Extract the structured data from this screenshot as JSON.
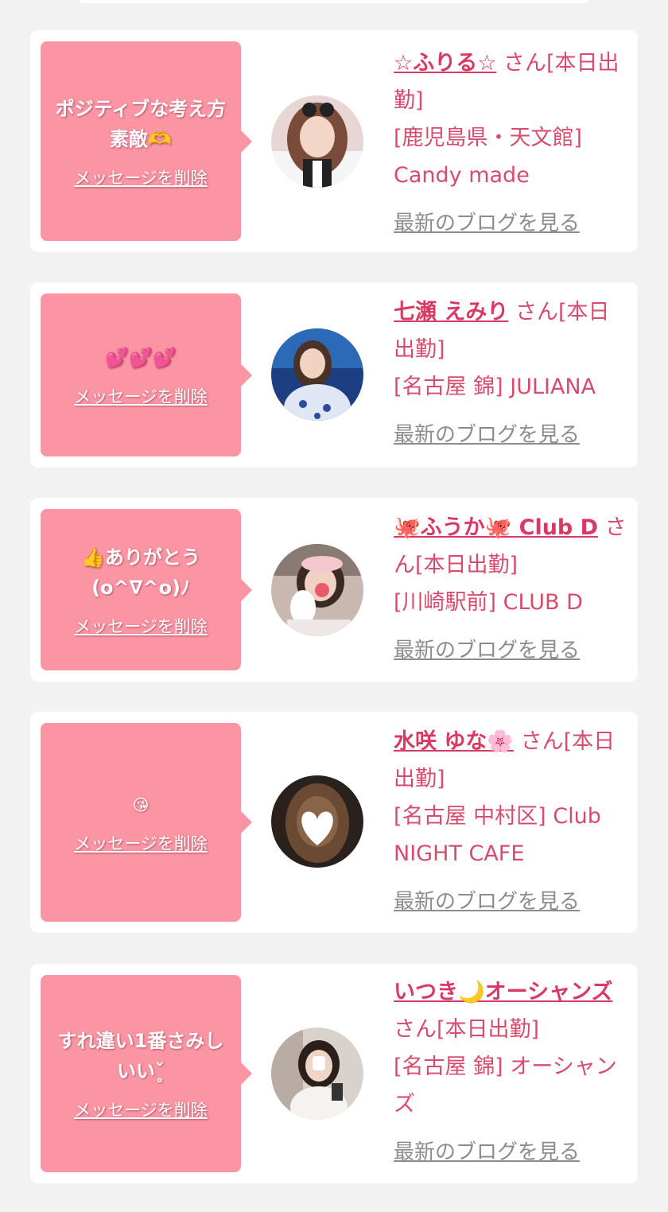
{
  "messages": [
    {
      "message": "ポジティブな考え方素敵🫶",
      "delete_label": "メッセージを削除",
      "name": "☆ふりる☆",
      "suffix": "さん[本日出勤]",
      "shop": "[鹿児島県・天文館] Candy made",
      "blog_label": "最新のブログを見る"
    },
    {
      "message": "💕💕💕",
      "delete_label": "メッセージを削除",
      "name": "七瀬 えみり",
      "suffix": "さん[本日出勤]",
      "shop": "[名古屋 錦] JULIANA",
      "blog_label": "最新のブログを見る"
    },
    {
      "message": "👍ありがとう(o^∇^o)ﾉ",
      "delete_label": "メッセージを削除",
      "name": "🐙ふうか🐙 Club D",
      "suffix": "さん[本日出勤]",
      "shop": "[川崎駅前] CLUB D",
      "blog_label": "最新のブログを見る"
    },
    {
      "message": "😘 ",
      "delete_label": "メッセージを削除",
      "name": "水咲 ゆな🌸",
      "suffix": "さん[本日出勤]",
      "shop": "[名古屋 中村区] Club NIGHT CAFE",
      "blog_label": "最新のブログを見る"
    },
    {
      "message": "すれ違い1番さみしいいˇ̥",
      "delete_label": "メッセージを削除",
      "name": "いつき🌙オーシャンズ",
      "suffix": "さん[本日出勤]",
      "shop": "[名古屋 錦] オーシャンズ",
      "blog_label": "最新のブログを見る"
    }
  ],
  "colors": {
    "bubble": "#fb95a4",
    "name": "#d93a63",
    "text": "#d94b6c",
    "blog_link": "#8c8c8c",
    "background": "#f2f2f2"
  }
}
